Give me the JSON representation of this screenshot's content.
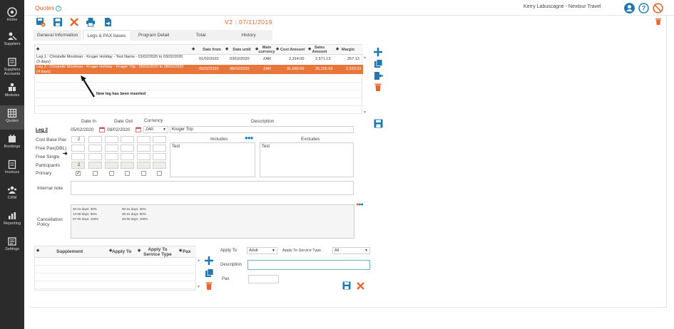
{
  "sidebar": {
    "items": [
      {
        "label": "Home",
        "icon": "home-icon"
      },
      {
        "label": "Suppliers",
        "icon": "suppliers-icon"
      },
      {
        "label": "Suppliers Accounts",
        "icon": "suppliers-accounts-icon"
      },
      {
        "label": "Modules",
        "icon": "modules-icon"
      },
      {
        "label": "Quotes",
        "icon": "quotes-icon",
        "active": true
      },
      {
        "label": "Bookings",
        "icon": "bookings-icon"
      },
      {
        "label": "Invoices",
        "icon": "invoices-icon"
      },
      {
        "label": "CRM",
        "icon": "crm-icon"
      },
      {
        "label": "Reporting",
        "icon": "reporting-icon"
      },
      {
        "label": "Settings",
        "icon": "settings-icon"
      }
    ]
  },
  "header": {
    "title": "Quotes",
    "help": "?",
    "user": "Kerry Labuscagne - Nextour Travel"
  },
  "version": "V2 : 07/11/2019",
  "tabs": [
    {
      "label": "General Information"
    },
    {
      "label": "Legs & PAX bases",
      "active": true
    },
    {
      "label": "Program Detail"
    },
    {
      "label": "Total"
    },
    {
      "label": "History"
    }
  ],
  "legs_table": {
    "headers": {
      "date_from": "Date from",
      "date_until": "Date until",
      "main_currency": "Main currency",
      "cost_amount": "Cost Amount",
      "sales_amount": "Sales Amount",
      "margin": "Margin"
    },
    "rows": [
      {
        "desc": "Leg 1 : Christelle Moolman - Kruger Holiday - Test Name - 01/02/2020 to 03/02/2020 (3 days)",
        "date_from": "01/02/2020",
        "date_until": "03/02/2020",
        "currency": "ZAR",
        "cost": "2,314.00",
        "sales": "2,571.13",
        "margin": "257.13"
      },
      {
        "desc": "Leg 2 : Christelle Moolman - Kruger Holiday - Kruger Trip - 05/02/2020 to 08/02/2020 (4 days)",
        "date_from": "05/02/2020",
        "date_until": "08/02/2020",
        "currency": "ZAR",
        "cost": "31,680.00",
        "sales": "35,200.03",
        "margin": "3,520.03",
        "selected": true
      }
    ]
  },
  "annotation": "New leg has been inserted",
  "leg_detail": {
    "leg_label": "Leg 2",
    "date_in_label": "Date In",
    "date_out_label": "Date Out",
    "currency_label": "Currency",
    "description_label": "Description",
    "date_in": "05/02/2020",
    "date_out": "08/02/2020",
    "currency": "ZAR",
    "description": "Kruger Trip",
    "cost_base_pax_label": "Cost Base Pax",
    "free_pax_dbl_label": "Free Pax(DBL)",
    "free_single_label": "Free Single",
    "participants_label": "Participants",
    "primary_label": "Primary",
    "cost_base_pax_value": "2",
    "participants_value": "2",
    "includes_label": "Includes",
    "excludes_label": "Excludes",
    "includes_text": "Test",
    "excludes_text": "Test",
    "internal_note_label": "Internal note"
  },
  "cancellation": {
    "label": "Cancellation Policy",
    "col1": [
      "30-15 days: 30%",
      "14-08 days: 50%",
      "07-00 days: 100%"
    ],
    "col2": [
      "60-31 days: 30%",
      "30-21 days: 50%",
      "20-00 days: 100%"
    ]
  },
  "supplement": {
    "headers": {
      "supplement": "Supplement",
      "apply_to": "Apply To",
      "apply_to_service_type": "Apply To Service Type",
      "pax": "Pax"
    },
    "form": {
      "apply_to_label": "Apply To",
      "apply_to_value": "Adult",
      "apply_to_service_type_label": "Apply To Service Type",
      "apply_to_service_type_value": "All",
      "description_label": "Description",
      "pax_label": "Pax"
    }
  },
  "colors": {
    "accent": "#e8642c",
    "selected_row": "#e8763b",
    "blue": "#1f78b4",
    "sidebar": "#2b2b2b"
  }
}
